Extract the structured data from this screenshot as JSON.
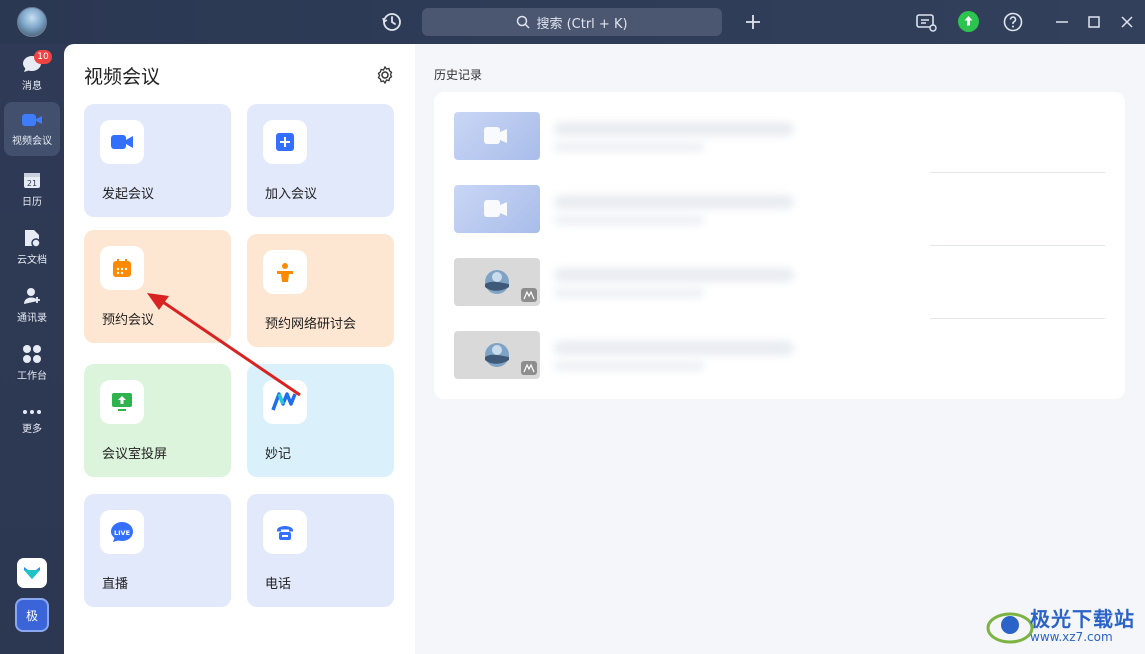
{
  "titlebar": {
    "search_label": "搜索 (Ctrl + K)"
  },
  "nav": {
    "items": [
      {
        "label": "消息",
        "badge": "10"
      },
      {
        "label": "视频会议"
      },
      {
        "label": "日历",
        "date": "21"
      },
      {
        "label": "云文档"
      },
      {
        "label": "通讯录"
      },
      {
        "label": "工作台"
      },
      {
        "label": "更多"
      }
    ],
    "ext_label": "极"
  },
  "main": {
    "title": "视频会议",
    "cards": [
      {
        "label": "发起会议"
      },
      {
        "label": "加入会议"
      },
      {
        "label": "预约会议"
      },
      {
        "label": "预约网络研讨会"
      },
      {
        "label": "会议室投屏"
      },
      {
        "label": "妙记"
      },
      {
        "label": "直播"
      },
      {
        "label": "电话"
      }
    ]
  },
  "history": {
    "title": "历史记录"
  },
  "watermark": {
    "brand": "极光下载站",
    "url": "www.xz7.com"
  },
  "colors": {
    "accent_blue": "#3370ff",
    "upgrade_green": "#2cc44f",
    "badge_red": "#f04444",
    "arrow_red": "#d92222"
  }
}
